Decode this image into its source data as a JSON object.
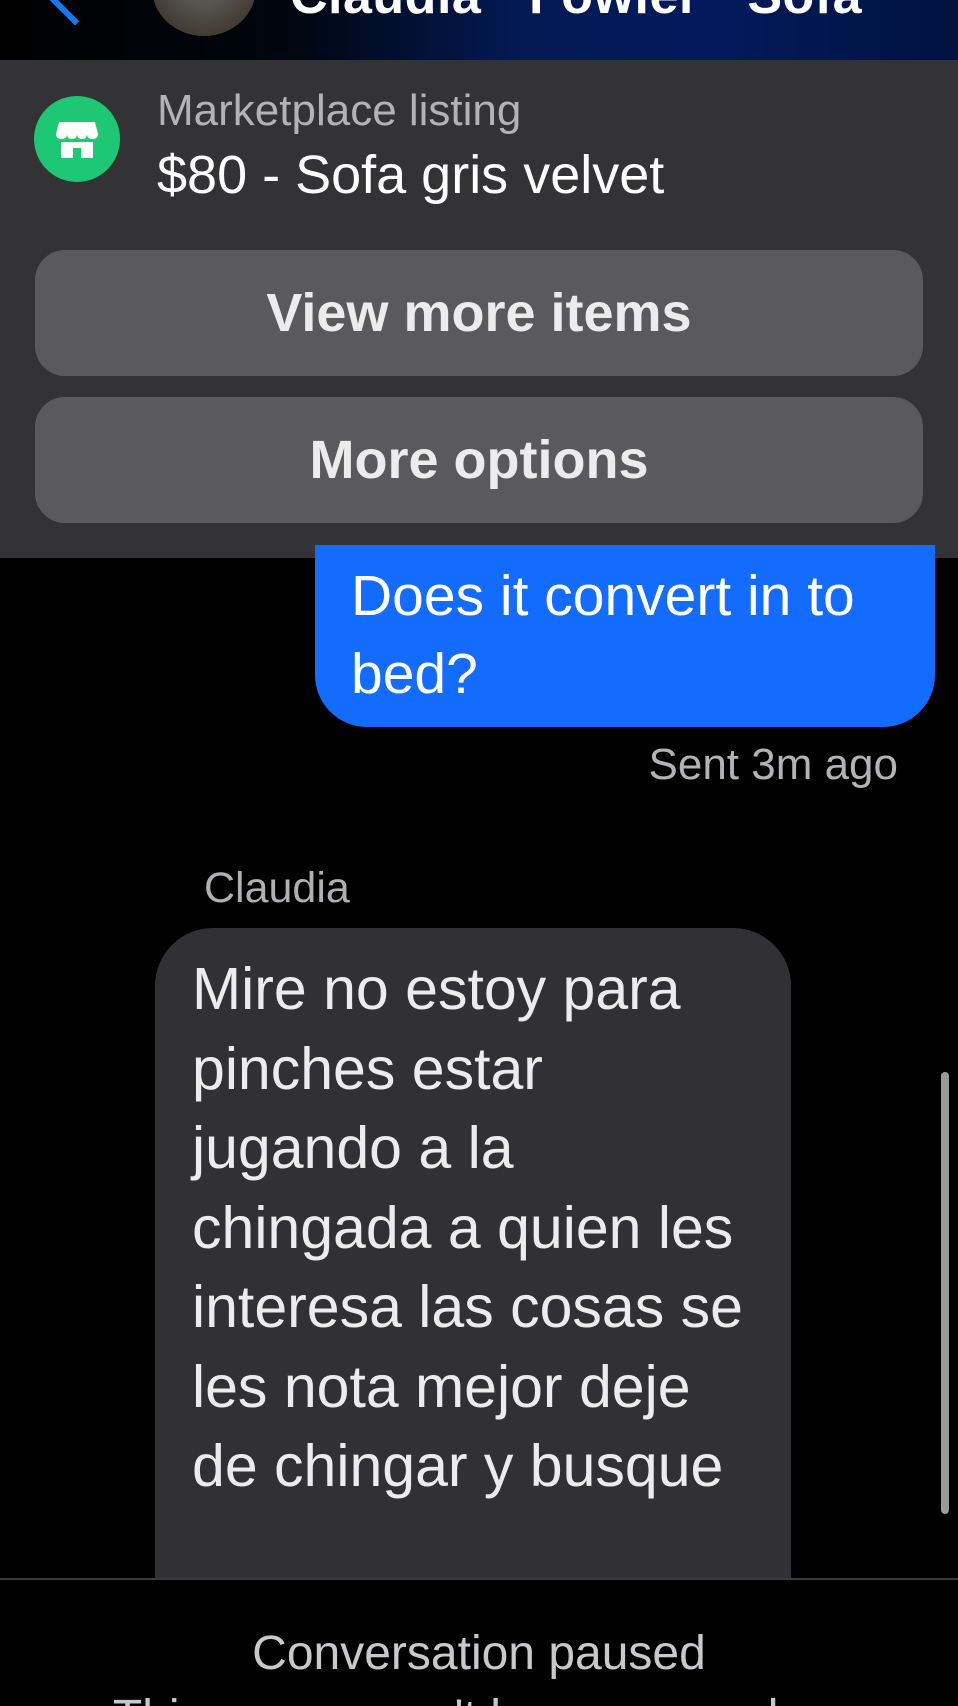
{
  "header": {
    "title": "Claudia · Fowler · Sofa"
  },
  "listing": {
    "label": "Marketplace listing",
    "title": "$80 - Sofa gris velvet",
    "icon": "marketplace-store-icon",
    "accent_color": "#1ec773",
    "view_more_label": "View more items",
    "more_options_label": "More options"
  },
  "messages": {
    "sent": {
      "text": "Does it convert  in to bed?",
      "status": "Sent 3m ago",
      "color": "#146cff"
    },
    "received": {
      "sender": "Claudia",
      "text": "Mire no estoy para pinches estar jugando a la chingada a quien les interesa las cosas se les nota mejor deje de chingar y busque"
    }
  },
  "footer": {
    "title": "Conversation paused",
    "subtitle": "This person can't be messaged on"
  }
}
